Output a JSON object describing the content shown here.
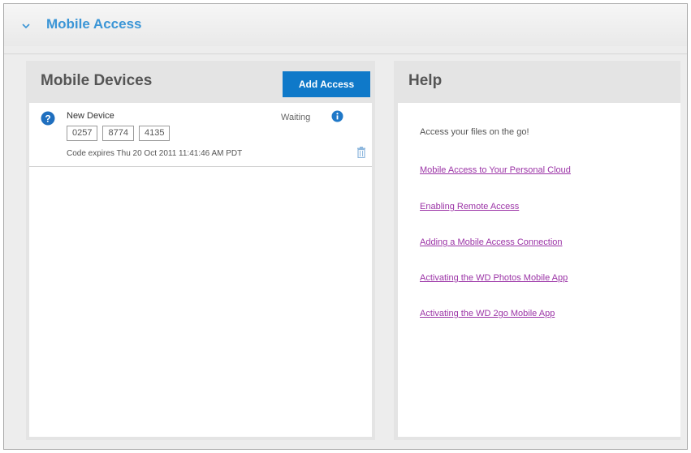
{
  "section": {
    "title": "Mobile Access"
  },
  "mobile_devices": {
    "title": "Mobile Devices",
    "add_button_label": "Add Access",
    "devices": [
      {
        "name": "New Device",
        "code": [
          "0257",
          "8774",
          "4135"
        ],
        "status": "Waiting",
        "expires": "Code expires Thu 20 Oct 2011 11:41:46 AM PDT"
      }
    ]
  },
  "help": {
    "title": "Help",
    "intro": "Access your files on the go!",
    "links": [
      "Mobile Access to Your Personal Cloud",
      "Enabling Remote Access",
      "Adding a Mobile Access Connection",
      "Activating the WD Photos Mobile App",
      "Activating the WD 2go Mobile App"
    ]
  },
  "colors": {
    "accent": "#3a95d6",
    "button": "#0f79c9",
    "link": "#9b33a6"
  }
}
